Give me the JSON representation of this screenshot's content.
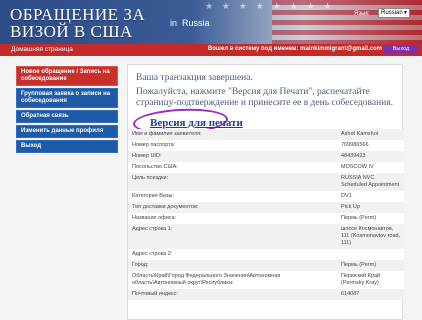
{
  "header": {
    "title_line1": "ОБРАЩЕНИЕ ЗА",
    "title_line2": "ВИЗОЙ В США",
    "country_prefix": "in",
    "country": "Russia",
    "language_label": "Язык:",
    "language_selected": "Russian",
    "stars": "★ ★ ★ ★ ★ ★ ★ ★"
  },
  "navbar": {
    "home": "Домашняя страница",
    "login_text": "Вошел в систему под именем: mainkimmigrant@gmail.com",
    "logout": "Выход"
  },
  "sidebar": {
    "items": [
      {
        "label": "Новое обращение / Запись на собеседование",
        "active": true
      },
      {
        "label": "Групповая заявка о записи на собеседования",
        "active": false
      },
      {
        "label": "Обратная связь",
        "active": false
      },
      {
        "label": "Изменить данные профиля",
        "active": false
      },
      {
        "label": "Выход",
        "active": false
      }
    ]
  },
  "main": {
    "message1": "Ваша транзакция завершена.",
    "message2": "Пожалуйста, нажмите \"Версия для Печати\", распечатайте страницу-подтверждение и принесите ее в день собеседования.",
    "print_link": "Версия для печати",
    "rows": [
      {
        "label": "Имя и фамилия заявителя:",
        "value": "Ashot Kamshot"
      },
      {
        "label": "Номер паспорта:",
        "value": "769986566"
      },
      {
        "label": "Номер UID:",
        "value": "48439423"
      },
      {
        "label": "Посольство США:",
        "value": "MOSCOW IV"
      },
      {
        "label": "Цель поездки:",
        "value": "RUSSIA NVC Scheduled Appointment"
      },
      {
        "label": "Категория Визы:",
        "value": "DV1"
      },
      {
        "label": "Тип доставки документов:",
        "value": "Pick Up"
      },
      {
        "label": "Название офиса:",
        "value": "Пермь (Perm)"
      },
      {
        "label": "Адрес строка 1:",
        "value": "шоссе Космонавтов, 111 (Kosmonavtov road, 111)"
      },
      {
        "label": "Адрес строка 2:",
        "value": ""
      },
      {
        "label": "Город:",
        "value": "Пермь (Perm)"
      },
      {
        "label": "Область\\Край\\Город Федерального Значения\\Автономная область\\Автономный округ\\Республика:",
        "value": "Пермский Край (Permsky Kray)"
      },
      {
        "label": "Почтовый индекс:",
        "value": "614087"
      }
    ]
  },
  "colors": {
    "nav_red": "#c42a2a",
    "sidebar_blue": "#1f5aa8",
    "active_red": "#c9302c",
    "highlight_oval": "#9b2dbd",
    "link_blue": "#1a3fa0"
  }
}
